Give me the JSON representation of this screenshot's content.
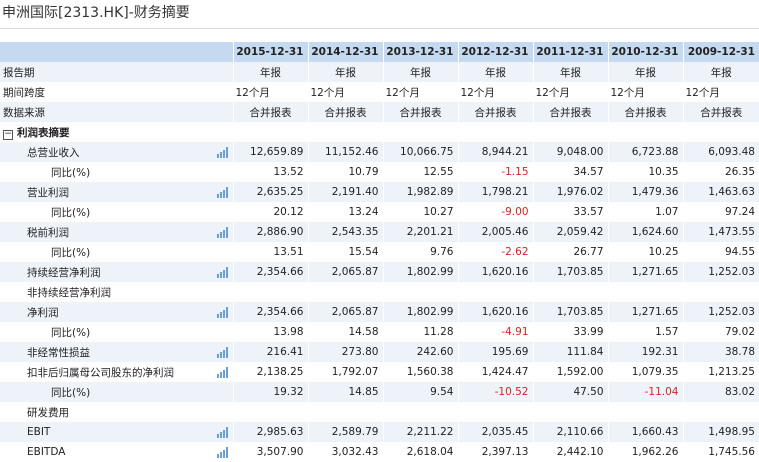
{
  "page": {
    "title": "申洲国际[2313.HK]-财务摘要"
  },
  "columns": [
    "2015-12-31",
    "2014-12-31",
    "2013-12-31",
    "2012-12-31",
    "2011-12-31",
    "2010-12-31",
    "2009-12-31"
  ],
  "rows": [
    {
      "label": "报告期",
      "indent": 0,
      "chart": false,
      "align": "center",
      "values": [
        "年报",
        "年报",
        "年报",
        "年报",
        "年报",
        "年报",
        "年报"
      ]
    },
    {
      "label": "期间跨度",
      "indent": 0,
      "chart": false,
      "align": "left",
      "values": [
        "12个月",
        "12个月",
        "12个月",
        "12个月",
        "12个月",
        "12个月",
        "12个月"
      ]
    },
    {
      "label": "数据来源",
      "indent": 0,
      "chart": false,
      "align": "center",
      "values": [
        "合并报表",
        "合并报表",
        "合并报表",
        "合并报表",
        "合并报表",
        "合并报表",
        "合并报表"
      ]
    },
    {
      "label": "利润表摘要",
      "indent": 0,
      "section": true,
      "chart": false,
      "values": [
        "",
        "",
        "",
        "",
        "",
        "",
        ""
      ]
    },
    {
      "label": "总营业收入",
      "indent": 1,
      "chart": true,
      "values": [
        "12,659.89",
        "11,152.46",
        "10,066.75",
        "8,944.21",
        "9,048.00",
        "6,723.88",
        "6,093.48"
      ]
    },
    {
      "label": "同比(%)",
      "indent": 2,
      "chart": false,
      "values": [
        "13.52",
        "10.79",
        "12.55",
        "-1.15",
        "34.57",
        "10.35",
        "26.35"
      ]
    },
    {
      "label": "营业利润",
      "indent": 1,
      "chart": true,
      "values": [
        "2,635.25",
        "2,191.40",
        "1,982.89",
        "1,798.21",
        "1,976.02",
        "1,479.36",
        "1,463.63"
      ]
    },
    {
      "label": "同比(%)",
      "indent": 2,
      "chart": false,
      "values": [
        "20.12",
        "13.24",
        "10.27",
        "-9.00",
        "33.57",
        "1.07",
        "97.24"
      ]
    },
    {
      "label": "税前利润",
      "indent": 1,
      "chart": true,
      "values": [
        "2,886.90",
        "2,543.35",
        "2,201.21",
        "2,005.46",
        "2,059.42",
        "1,624.60",
        "1,473.55"
      ]
    },
    {
      "label": "同比(%)",
      "indent": 2,
      "chart": false,
      "values": [
        "13.51",
        "15.54",
        "9.76",
        "-2.62",
        "26.77",
        "10.25",
        "94.55"
      ]
    },
    {
      "label": "持续经营净利润",
      "indent": 1,
      "chart": true,
      "values": [
        "2,354.66",
        "2,065.87",
        "1,802.99",
        "1,620.16",
        "1,703.85",
        "1,271.65",
        "1,252.03"
      ]
    },
    {
      "label": "非持续经营净利润",
      "indent": 1,
      "chart": false,
      "values": [
        "",
        "",
        "",
        "",
        "",
        "",
        ""
      ]
    },
    {
      "label": "净利润",
      "indent": 1,
      "chart": true,
      "values": [
        "2,354.66",
        "2,065.87",
        "1,802.99",
        "1,620.16",
        "1,703.85",
        "1,271.65",
        "1,252.03"
      ]
    },
    {
      "label": "同比(%)",
      "indent": 2,
      "chart": false,
      "values": [
        "13.98",
        "14.58",
        "11.28",
        "-4.91",
        "33.99",
        "1.57",
        "79.02"
      ]
    },
    {
      "label": "非经常性损益",
      "indent": 1,
      "chart": true,
      "values": [
        "216.41",
        "273.80",
        "242.60",
        "195.69",
        "111.84",
        "192.31",
        "38.78"
      ]
    },
    {
      "label": "扣非后归属母公司股东的净利润",
      "indent": 1,
      "chart": true,
      "values": [
        "2,138.25",
        "1,792.07",
        "1,560.38",
        "1,424.47",
        "1,592.00",
        "1,079.35",
        "1,213.25"
      ]
    },
    {
      "label": "同比(%)",
      "indent": 2,
      "chart": false,
      "values": [
        "19.32",
        "14.85",
        "9.54",
        "-10.52",
        "47.50",
        "-11.04",
        "83.02"
      ]
    },
    {
      "label": "研发费用",
      "indent": 1,
      "chart": false,
      "values": [
        "",
        "",
        "",
        "",
        "",
        "",
        ""
      ]
    },
    {
      "label": "EBIT",
      "indent": 1,
      "chart": true,
      "values": [
        "2,985.63",
        "2,589.79",
        "2,211.22",
        "2,035.45",
        "2,110.66",
        "1,660.43",
        "1,498.95"
      ]
    },
    {
      "label": "EBITDA",
      "indent": 1,
      "chart": true,
      "values": [
        "3,507.90",
        "3,032.43",
        "2,618.04",
        "2,397.13",
        "2,442.10",
        "1,962.26",
        "1,745.56"
      ]
    }
  ],
  "colors": {
    "header_bg": "#c5d9f1",
    "stripe": "#eef3fa",
    "negative": "#e02020",
    "chart_icon": "#6a9fd8"
  },
  "icons": {
    "chart": "bar-chart-icon",
    "collapse": "collapse-minus-icon"
  }
}
